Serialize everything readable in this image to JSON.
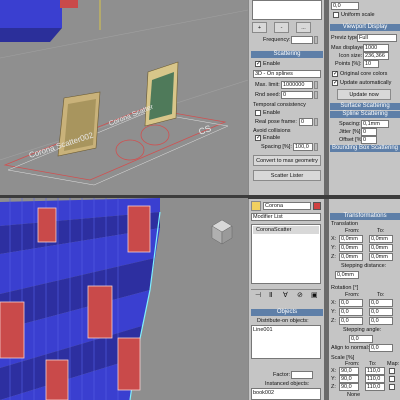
{
  "top_panel": {
    "frequency_label": "Frequency:",
    "btn_plus": "+",
    "btn_minus": "-",
    "btn_dots": "...",
    "scattering_header": "Scattering",
    "enable_label": "Enable",
    "mode_value": "3D - On splines",
    "max_limit_label": "Max. limit:",
    "max_limit_value": "1000000",
    "rnd_seed_label": "Rnd seed:",
    "rnd_seed_value": "0",
    "temporal_label": "Temporal consistency",
    "temporal_enable_label": "Enable",
    "real_pose_label": "Real pose frame:",
    "real_pose_value": "0",
    "avoid_label": "Avoid collisions",
    "avoid_enable_label": "Enable",
    "spacing_label": "Spacing [%]:",
    "spacing_value": "100,0",
    "convert_btn": "Convert to max geometry",
    "lister_btn": "Scatter Lister"
  },
  "right_top_panel": {
    "top_value": "0,0",
    "uniform_label": "Uniform scale",
    "viewport_display_header": "Viewport Display",
    "preview_type_label": "Previz type:",
    "preview_type_value": "Full",
    "max_displayed_label": "Max displayed:",
    "max_displayed_value": "1000",
    "icon_size_label": "Icon size:",
    "icon_size_value": "236,366",
    "points_label": "Points [%]:",
    "points_value": "10",
    "original_colors_label": "Original core colors",
    "update_auto_label": "Update automatically",
    "update_now_btn": "Update now",
    "surface_header": "Surface Scattering",
    "spline_header": "Spline Scattering",
    "spacing_label": "Spacing:",
    "spacing_value": "0,1mm",
    "jitter_label": "Jitter [%]:",
    "jitter_value": "0",
    "offset_label": "Offset [%]:",
    "offset_value": "0",
    "bounding_header": "Bounding Box Scattering"
  },
  "scene_text": {
    "label1": "Corona Scatter002",
    "label2": "Corona Scatter",
    "cs": "CS"
  },
  "modifier_panel": {
    "object_name": "Corona Scatter002",
    "modifier_list": "Modifier List",
    "stack_item": "CoronaScatter",
    "objects_header": "Objects",
    "distribute_label": "Distribute-on objects:",
    "distribute_item": "Line001",
    "factor_label": "Factor:",
    "instanced_label": "Instanced objects:",
    "instanced_item": "book002",
    "btn_plus": "+",
    "btn_minus": "-"
  },
  "transform_panel": {
    "header": "Transformations",
    "translation_label": "Translation",
    "from_label": "From:",
    "to_label": "To:",
    "tx_from": "0,0mm",
    "tx_to": "0,0mm",
    "ty_from": "0,0mm",
    "ty_to": "0,0mm",
    "tz_from": "0,0mm",
    "tz_to": "0,0mm",
    "stepping_label": "Stepping distance:",
    "stepping_value": "0,0mm",
    "rotation_label": "Rotation [°]",
    "rx_from": "0,0",
    "rx_to": "0,0",
    "ry_from": "0,0",
    "ry_to": "0,0",
    "rz_from": "0,0",
    "rz_to": "0,0",
    "step_angle_label": "Stepping angle:",
    "step_angle_value": "0,0",
    "align_label": "Align to normal:",
    "align_value": "0,0",
    "scale_label": "Scale [%]",
    "map_label": "Map:",
    "sx_from": "90,0",
    "sx_to": "110,0",
    "sy_from": "90,0",
    "sy_to": "110,0",
    "sz_from": "90,0",
    "sz_to": "110,0",
    "map_none": "None",
    "mode_label": "Mode:",
    "mode_value": "Map fixed",
    "step_pct_label": "Stepping percentage:"
  },
  "colors": {
    "viewport_bg": "#8f8f8f",
    "header_blue": "#5e7fa8",
    "book_blue": "#3a3fd0",
    "book_red": "#c94a4a",
    "outline_red": "#d05050"
  }
}
